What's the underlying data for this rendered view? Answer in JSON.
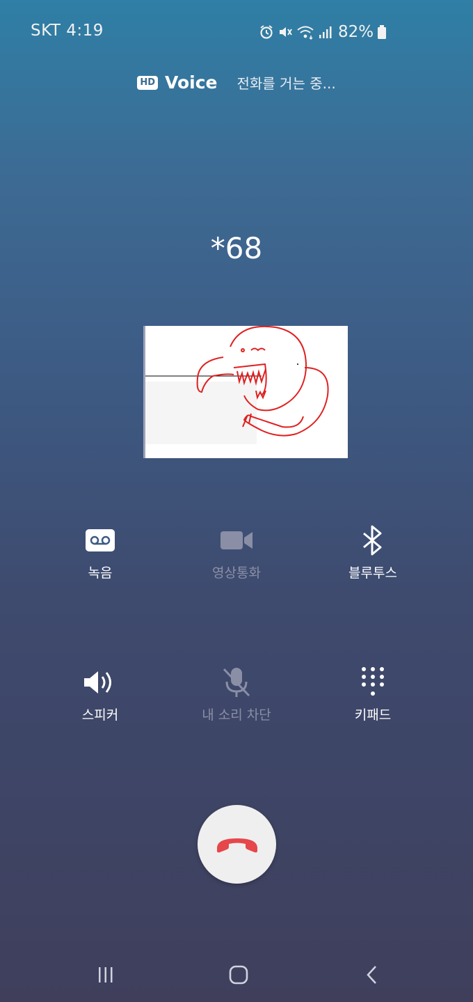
{
  "status_bar": {
    "carrier_time": "SKT 4:19",
    "battery": "82%",
    "icons": [
      "alarm-icon",
      "mute-icon",
      "wifi-icon",
      "signal-icon",
      "battery-icon"
    ]
  },
  "call": {
    "hd_badge": "HD",
    "voice_label": "Voice",
    "status": "전화를 거는 중...",
    "number": "*68"
  },
  "controls": {
    "record": {
      "label": "녹음",
      "icon": "voicemail-icon",
      "enabled": true
    },
    "video": {
      "label": "영상통화",
      "icon": "video-camera-icon",
      "enabled": false
    },
    "bluetooth": {
      "label": "블루투스",
      "icon": "bluetooth-icon",
      "enabled": true
    },
    "speaker": {
      "label": "스피커",
      "icon": "speaker-icon",
      "enabled": true
    },
    "mute": {
      "label": "내 소리 차단",
      "icon": "mic-off-icon",
      "enabled": false
    },
    "keypad": {
      "label": "키패드",
      "icon": "keypad-icon",
      "enabled": true
    }
  },
  "end_call": {
    "icon": "phone-hangup-icon",
    "color": "#e5474b"
  },
  "nav": {
    "icons": [
      "recents-icon",
      "home-icon",
      "back-icon"
    ]
  },
  "colors": {
    "accent_end": "#e5474b",
    "dim_text": "#8a8fa6"
  }
}
